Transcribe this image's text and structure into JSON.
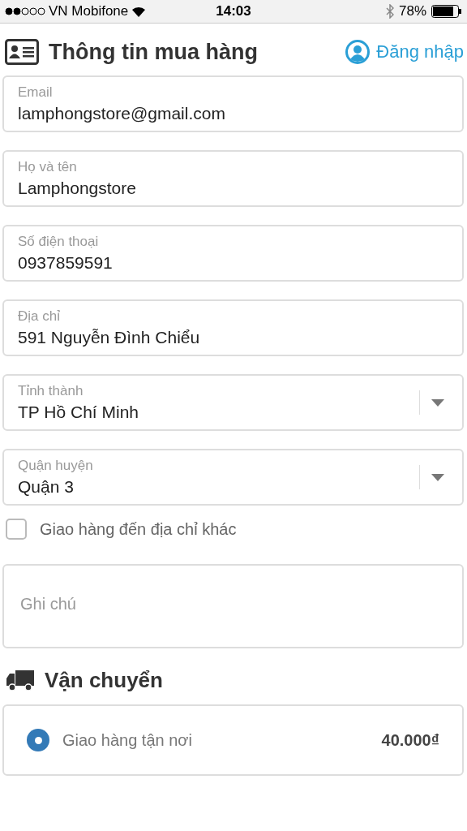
{
  "status_bar": {
    "carrier": "VN Mobifone",
    "time": "14:03",
    "battery": "78%"
  },
  "header": {
    "title": "Thông tin mua hàng",
    "login": "Đăng nhập"
  },
  "fields": [
    {
      "kind": "text",
      "label": "Email",
      "value": "lamphongstore@gmail.com"
    },
    {
      "kind": "text",
      "label": "Họ và tên",
      "value": "Lamphongstore"
    },
    {
      "kind": "text",
      "label": "Số điện thoại",
      "value": "0937859591"
    },
    {
      "kind": "text",
      "label": "Địa chỉ",
      "value": "591 Nguyễn Đình Chiểu"
    },
    {
      "kind": "select",
      "label": "Tỉnh thành",
      "value": "TP Hồ Chí Minh"
    },
    {
      "kind": "select",
      "label": "Quận huyện",
      "value": "Quận 3"
    }
  ],
  "other_address": {
    "label": "Giao hàng đến địa chỉ khác",
    "checked": false
  },
  "note": {
    "placeholder": "Ghi chú"
  },
  "shipping": {
    "title": "Vận chuyển",
    "options": [
      {
        "label": "Giao hàng tận nơi",
        "price": "40.000₫",
        "selected": true
      }
    ]
  }
}
